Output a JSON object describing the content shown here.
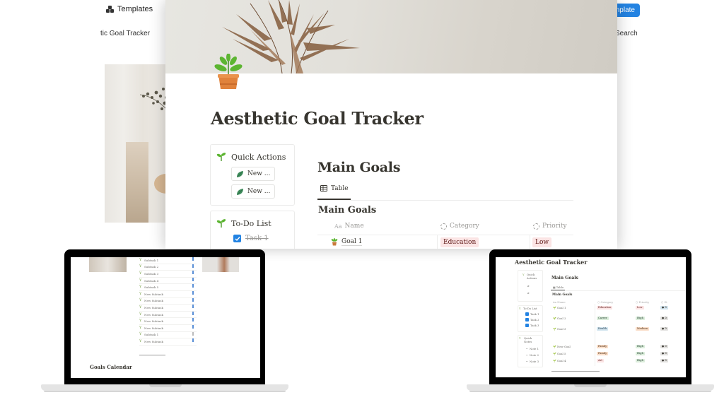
{
  "background_site": {
    "nav_templates_label": "Templates",
    "breadcrumb_partial": "tic Goal Tracker",
    "cta_partial": "nplate",
    "search_partial": "Search"
  },
  "page": {
    "title": "Aesthetic Goal Tracker",
    "icon": "potted-plant",
    "cover": "dried-palm-leaf-on-beige-wall"
  },
  "quick_actions": {
    "title": "Quick Actions",
    "buttons": [
      {
        "label": "New ..."
      },
      {
        "label": "New ..."
      }
    ]
  },
  "todo_list": {
    "title": "To-Do List",
    "items": [
      {
        "label": "Task 1",
        "checked": true
      }
    ]
  },
  "main_goals": {
    "heading": "Main Goals",
    "view_tab": "Table",
    "database_title": "Main Goals",
    "columns": [
      "Name",
      "Category",
      "Priority"
    ],
    "column_icons": [
      "Aa",
      "select-circle",
      "select-circle"
    ],
    "rows": [
      {
        "name": "Goal 1",
        "category": "Education",
        "priority": "Low"
      }
    ]
  },
  "colors": {
    "accent_blue": "#2383e2",
    "tag_red_bg": "#fbe4e4",
    "tag_red_text": "#5d1715",
    "text": "#37352f",
    "muted": "#9b9a97"
  },
  "left_laptop": {
    "subitems": [
      "Subtask 1",
      "Subtask 2",
      "Subtask 3",
      "Subtask 4",
      "Subtask 5",
      "New Subtask",
      "New Subtask",
      "New Subtask",
      "New Subtask",
      "New Subtask",
      "New Subtask",
      "Subtask 1",
      "New Subtask"
    ],
    "section_title": "Goals Calendar"
  },
  "right_laptop": {
    "title": "Aesthetic Goal Tracker",
    "quick_actions": "Quick Actions",
    "todo_title": "To-Do List",
    "todo_items": [
      "Task 1",
      "Task 2",
      "Task 3"
    ],
    "quick_notes_title": "Quick Notes",
    "notes": [
      "Note 1",
      "Note 2",
      "Note 3"
    ],
    "main_goals_heading": "Main Goals",
    "view_tab": "Table",
    "database_title": "Main Goals",
    "columns": [
      "Aa Name",
      "Category",
      "Priority",
      "St"
    ],
    "rows": [
      {
        "name": "Goal 1",
        "category": "Education",
        "priority": "Low"
      },
      {
        "name": "Goal 2",
        "category": "Career",
        "priority": "High"
      },
      {
        "name": "Goal 3",
        "category": "Health",
        "priority": "Medium"
      },
      {
        "name": "New Goal",
        "category": "Family",
        "priority": "High"
      },
      {
        "name": "Goal 5",
        "category": "Family",
        "priority": "High"
      },
      {
        "name": "Goal 4",
        "category": "Art",
        "priority": "High"
      }
    ]
  }
}
